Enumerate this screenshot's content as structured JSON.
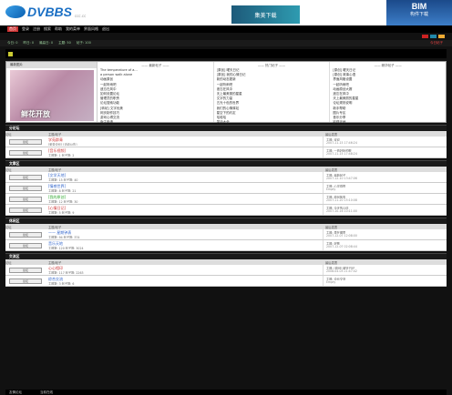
{
  "header": {
    "logo_text": "DVBBS",
    "logo_sub": "ccc.cc",
    "banner1": "集美下载",
    "banner2_title": "BIM",
    "banner2_sub": "构件下载"
  },
  "nav": [
    "首页",
    "登录",
    "注册",
    "搜索",
    "帮助",
    "我的菜单",
    "界面风格",
    "退出"
  ],
  "ticker": {
    "items": [
      "今日: 0",
      "昨日: 0",
      "最高日: 0",
      "主题: 50",
      "帖子: 100"
    ],
    "red": "今日帖子"
  },
  "featured": {
    "header": "最新图片",
    "caption": "鲜花开放",
    "cols": [
      {
        "head": "最新帖子",
        "items": [
          "The temperature of a...",
          "a person walk alone",
          "动画原创",
          "一起听雨吧",
          "遗忘在风中",
          "如何设置论坛",
          "管理员的职责",
          "论坛搜索功能",
          "[转帖] 文字优美",
          "网页制作技巧",
          "游戏心得交流",
          "版主申请"
        ]
      },
      {
        "head": "热门帖子",
        "items": [
          "[原创] 曜天日记",
          "[原创] 我的心情日记",
          "新的动态更新",
          "一起听雨吧",
          "遗忘在风中",
          "天上最美丽的星星",
          "文字的力量",
          "五光十色的世界",
          "我们的心情驿站",
          "星空下的约定",
          "哈哈哈",
          "笑话大全"
        ]
      },
      {
        "head": "精华帖子",
        "items": [
          "[原创] 曜天日记",
          "[原创] 故事心语",
          "界面风格设置",
          "一起听雨吧",
          "动画原创大赛",
          "遗忘在风中",
          "天上最美丽的星星",
          "论坛规则说明",
          "新手帮助",
          "图片专区",
          "音乐分享",
          "影视天地"
        ]
      }
    ]
  },
  "sections": [
    {
      "title": "分论坛",
      "cols": [
        "论坛",
        "主题/帖子",
        "最后发表"
      ],
      "rows": [
        {
          "btn": "论坛",
          "title": "学苑群青",
          "title_color": "red",
          "desc": "[紫金论坛] [活动公告]",
          "last1": "主题: 欢迎",
          "last2": "2007-11-15 17:46:24"
        },
        {
          "btn": "论坛",
          "title": "[音乐视频]",
          "title_color": "red",
          "desc": "主题数: 1 帖子数: 2",
          "last1": "主题: 一首好听的歌",
          "last2": "2007-11-15 17:48:24"
        }
      ]
    },
    {
      "title": "文章区",
      "cols": [
        "论坛",
        "主题/帖子",
        "最后发表"
      ],
      "rows": [
        {
          "btn": "论坛",
          "title": "[文学天地]",
          "title_color": "blue",
          "desc": "主题数: 15 帖子数: 40",
          "last1": "主题: 最新帖子",
          "last2": "2007-12-10 13:47:06"
        },
        {
          "btn": "论坛",
          "title": "[情感世界]",
          "title_color": "blue",
          "desc": "主题数: 8 帖子数: 21",
          "last1": "主题: 心灵感悟",
          "last2": "Empty"
        },
        {
          "btn": "论坛",
          "title": "[我的原创]",
          "title_color": "grn",
          "desc": "主题数: 12 帖子数: 30",
          "last1": "主题: 原创故事",
          "last2": "2007-11-20 15:10:08"
        },
        {
          "btn": "论坛",
          "title": "[心情日记]",
          "title_color": "red",
          "desc": "主题数: 5 帖子数: 9",
          "last1": "主题: 今天的心情",
          "last2": "2007-10-16 10:11:00"
        }
      ]
    },
    {
      "title": "休闲区",
      "cols": [
        "论坛",
        "主题/帖子",
        "最后发表"
      ],
      "rows": [
        {
          "btn": "论坛",
          "title": "——  星期钟表",
          "title_color": "blue",
          "desc": "主题数: 94 帖子数: 374",
          "last1": "主题: 表在哪里",
          "last2": "2007-12-07 12:08:00"
        },
        {
          "btn": "论坛",
          "title": "音乐天地",
          "title_color": "blue",
          "desc": "主题数: 120 帖子数: 3024",
          "last1": "主题: 好歌",
          "last2": "2007-12-07 02:08:44"
        }
      ]
    },
    {
      "title": "交流区",
      "cols": [
        "论坛",
        "主题/帖子",
        "最后发表"
      ],
      "rows": [
        {
          "btn": "论坛",
          "title": "心心相印",
          "title_color": "red",
          "desc": "主题数: 117 帖子数: 2263",
          "last1": "主题: [原创] 曜天日记",
          "last2": "2008-04-03 21:47:42"
        },
        {
          "btn": "论坛",
          "title": "综合交流",
          "title_color": "blue",
          "desc": "主题数: 3 帖子数: 6",
          "last1": "主题: 论坛交流",
          "last2": "Empty"
        }
      ]
    }
  ],
  "footer": [
    "友情论坛",
    "当前在线"
  ]
}
